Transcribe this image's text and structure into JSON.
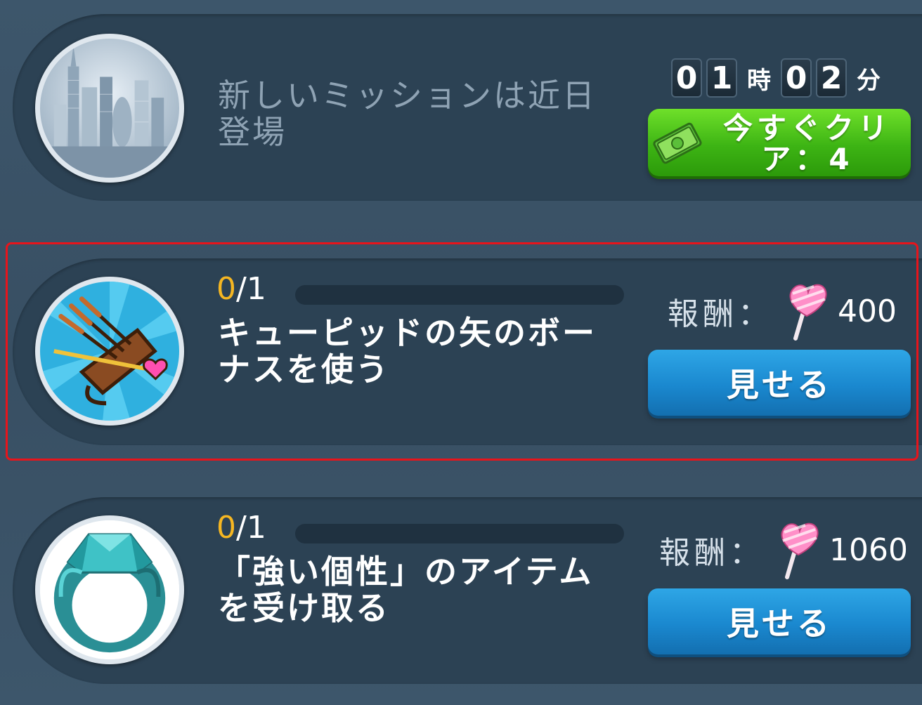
{
  "missions": [
    {
      "icon": "city-skyline-icon",
      "title": "新しいミッションは近日登場",
      "timer": {
        "h1": "0",
        "h2": "1",
        "hour_unit": "時",
        "m1": "0",
        "m2": "2",
        "min_unit": "分"
      },
      "clear_button": {
        "label": "今すぐクリア：4",
        "icon": "cash-icon"
      }
    },
    {
      "icon": "cupid-arrow-quiver-icon",
      "progress_current": "0",
      "progress_total": "/1",
      "progress_fraction": 0,
      "title": "キューピッドの矢のボーナスを使う",
      "reward_label": "報酬：",
      "reward_icon": "heart-lollipop-icon",
      "reward_value": "400",
      "button_label": "見せる"
    },
    {
      "icon": "crystal-ring-icon",
      "progress_current": "0",
      "progress_total": "/1",
      "progress_fraction": 0,
      "title": "「強い個性」のアイテムを受け取る",
      "reward_label": "報酬：",
      "reward_icon": "heart-lollipop-icon",
      "reward_value": "1060",
      "button_label": "見せる"
    }
  ],
  "colors": {
    "background": "#3b5468",
    "progress_accent": "#f5b622",
    "button_blue": "#1a88cf",
    "button_green": "#3db414",
    "highlight_border": "#e8141b"
  }
}
